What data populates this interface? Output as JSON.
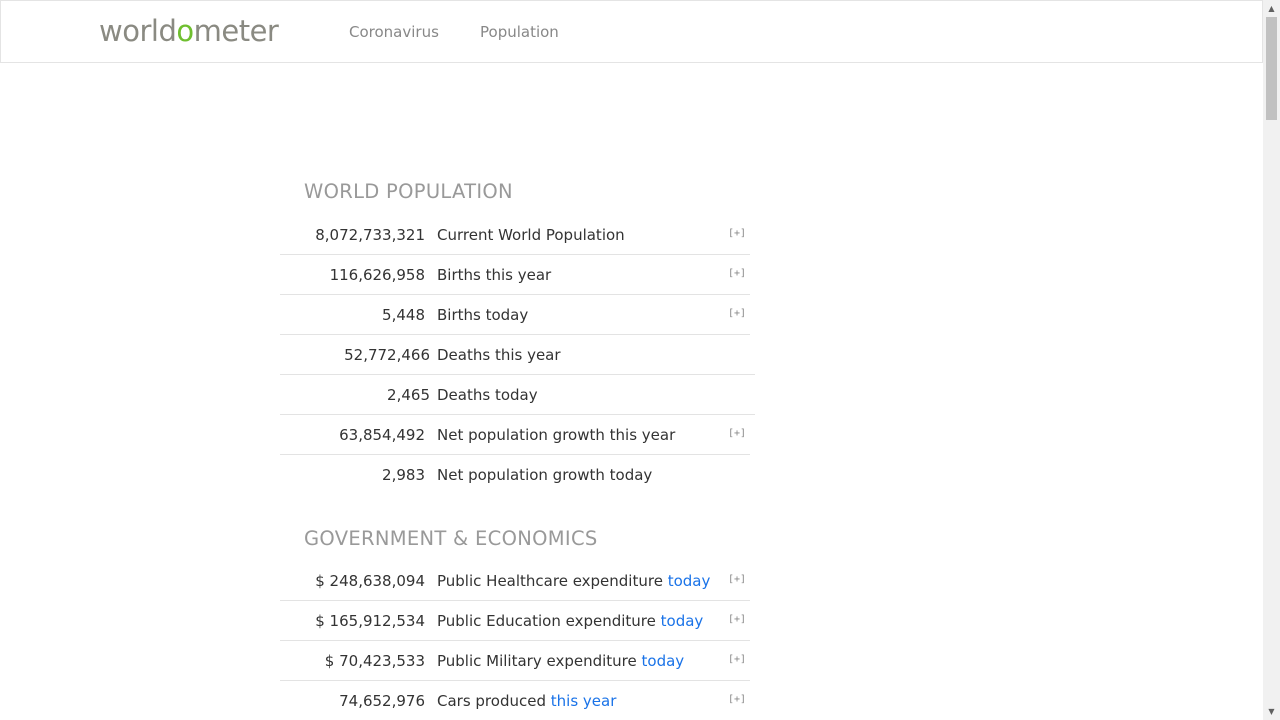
{
  "header": {
    "logo_prefix": "world",
    "logo_o": "o",
    "logo_suffix": "meter",
    "nav": [
      {
        "label": "Coronavirus"
      },
      {
        "label": "Population"
      }
    ]
  },
  "world_population": {
    "title": "WORLD POPULATION",
    "rows": [
      {
        "value": "8,072,733,321",
        "label": "Current World Population",
        "expand": "[+]"
      },
      {
        "value": "116,626,958",
        "label": "Births this year",
        "expand": "[+]"
      },
      {
        "value": "5,448",
        "label": "Births today",
        "expand": "[+]"
      },
      {
        "value": "52,772,466",
        "label": "Deaths this year"
      },
      {
        "value": "2,465",
        "label": "Deaths today"
      },
      {
        "value": "63,854,492",
        "label": "Net population growth this year",
        "expand": "[+]"
      },
      {
        "value": "2,983",
        "label": "Net population growth today"
      }
    ]
  },
  "gov_economics": {
    "title": "GOVERNMENT & ECONOMICS",
    "rows": [
      {
        "value": "$ 248,638,094",
        "label": "Public Healthcare expenditure",
        "highlight": "today",
        "expand": "[+]"
      },
      {
        "value": "$ 165,912,534",
        "label": "Public Education expenditure",
        "highlight": "today",
        "expand": "[+]"
      },
      {
        "value": "$ 70,423,533",
        "label": "Public Military expenditure",
        "highlight": "today",
        "expand": "[+]"
      },
      {
        "value": "74,652,976",
        "label": "Cars produced",
        "highlight": "this year",
        "expand": "[+]"
      }
    ]
  },
  "scrollbar": {
    "up_icon": "▲",
    "down_icon": "▼"
  }
}
